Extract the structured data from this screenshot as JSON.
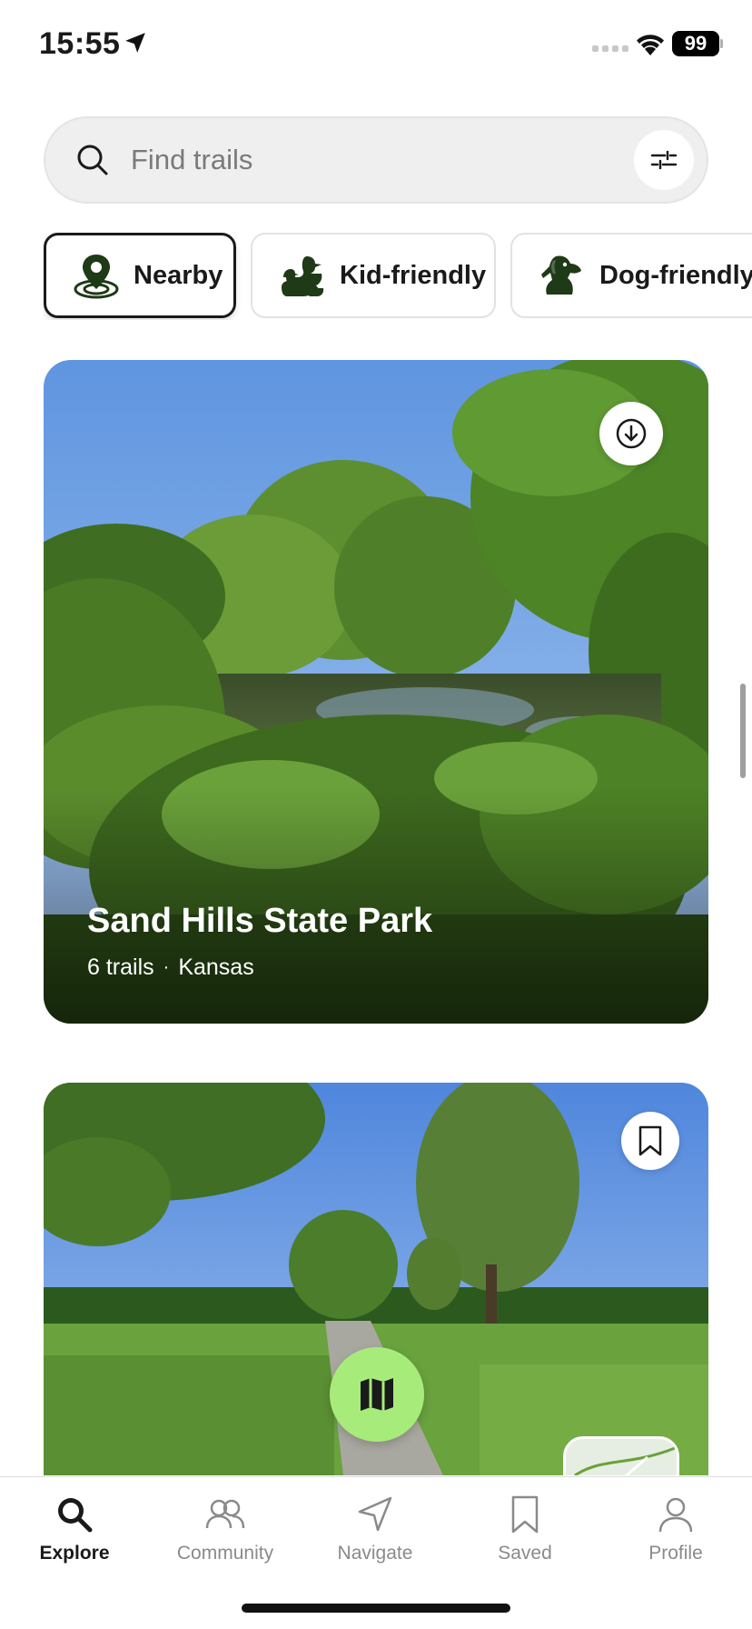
{
  "status_bar": {
    "time": "15:55",
    "battery": "99"
  },
  "search": {
    "placeholder": "Find trails",
    "value": ""
  },
  "chips": [
    {
      "label": "Nearby",
      "selected": true,
      "icon": "nearby-pin-icon"
    },
    {
      "label": "Kid-friendly",
      "selected": false,
      "icon": "duck-family-icon"
    },
    {
      "label": "Dog-friendly",
      "selected": false,
      "icon": "dog-icon"
    }
  ],
  "cards": [
    {
      "title": "Sand Hills State Park",
      "trails": "6 trails",
      "separator": "·",
      "region": "Kansas",
      "action_icon": "download-icon"
    },
    {
      "title": "",
      "trails": "",
      "region": "",
      "action_icon": "bookmark-icon"
    }
  ],
  "nav": {
    "items": [
      {
        "label": "Explore",
        "icon": "search-icon",
        "active": true
      },
      {
        "label": "Community",
        "icon": "people-icon",
        "active": false
      },
      {
        "label": "Navigate",
        "icon": "navigate-arrow-icon",
        "active": false
      },
      {
        "label": "Saved",
        "icon": "bookmark-icon",
        "active": false
      },
      {
        "label": "Profile",
        "icon": "person-icon",
        "active": false
      }
    ]
  },
  "colors": {
    "accent_green": "#a7ec7a",
    "icon_green": "#1f3a16",
    "text_primary": "#1a1a1a",
    "text_muted": "#8a8a8a"
  }
}
